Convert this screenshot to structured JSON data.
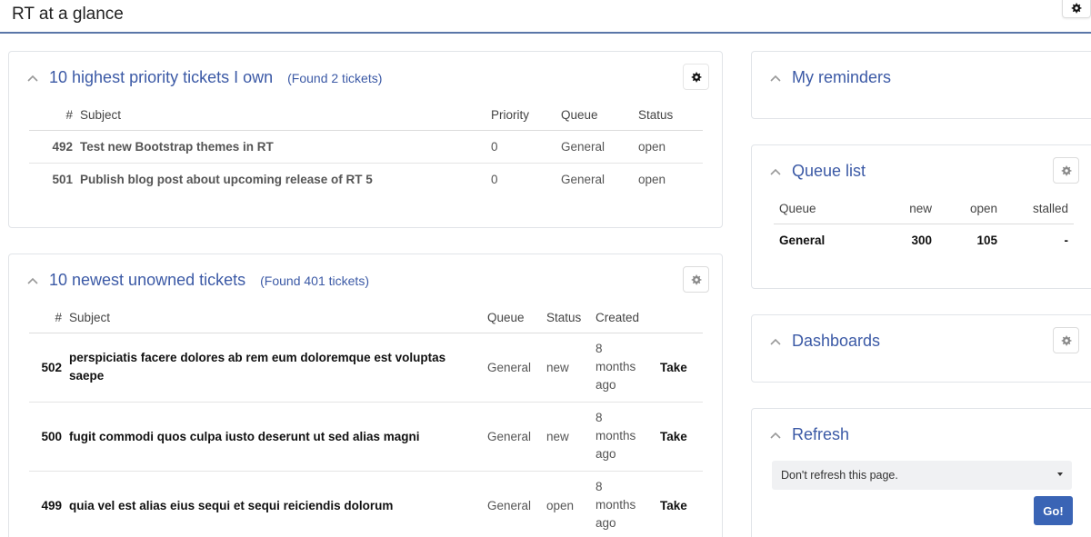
{
  "page": {
    "title": "RT at a glance"
  },
  "priority_panel": {
    "title": "10 highest priority tickets I own",
    "found": "(Found 2 tickets)",
    "columns": {
      "num": "#",
      "subject": "Subject",
      "priority": "Priority",
      "queue": "Queue",
      "status": "Status"
    },
    "rows": [
      {
        "num": "492",
        "subject": "Test new Bootstrap themes in RT",
        "priority": "0",
        "queue": "General",
        "status": "open"
      },
      {
        "num": "501",
        "subject": "Publish blog post about upcoming release of RT 5",
        "priority": "0",
        "queue": "General",
        "status": "open"
      }
    ]
  },
  "unowned_panel": {
    "title": "10 newest unowned tickets",
    "found": "(Found 401 tickets)",
    "columns": {
      "num": "#",
      "subject": "Subject",
      "queue": "Queue",
      "status": "Status",
      "created": "Created"
    },
    "rows": [
      {
        "num": "502",
        "subject": "perspiciatis facere dolores ab rem eum doloremque est voluptas saepe",
        "queue": "General",
        "status": "new",
        "created_1": "8",
        "created_2": "months",
        "created_3": "ago",
        "action": "Take"
      },
      {
        "num": "500",
        "subject": "fugit commodi quos culpa iusto deserunt ut sed alias magni",
        "queue": "General",
        "status": "new",
        "created_1": "8",
        "created_2": "months",
        "created_3": "ago",
        "action": "Take"
      },
      {
        "num": "499",
        "subject": "quia vel est alias eius sequi et sequi reiciendis dolorum",
        "queue": "General",
        "status": "open",
        "created_1": "8",
        "created_2": "months",
        "created_3": "ago",
        "action": "Take"
      }
    ]
  },
  "reminders_panel": {
    "title": "My reminders"
  },
  "queue_panel": {
    "title": "Queue list",
    "columns": {
      "queue": "Queue",
      "new": "new",
      "open": "open",
      "stalled": "stalled"
    },
    "rows": [
      {
        "queue": "General",
        "new": "300",
        "open": "105",
        "stalled": "-"
      }
    ]
  },
  "dashboards_panel": {
    "title": "Dashboards"
  },
  "refresh_panel": {
    "title": "Refresh",
    "selected": "Don't refresh this page.",
    "go_label": "Go!"
  },
  "icons": {
    "gear": "gear-icon",
    "collapse": "chevron-up-icon",
    "dropdown": "caret-down-icon"
  },
  "colors": {
    "accent": "#3c5aa6",
    "button": "#3a64b5",
    "rule": "#5a76a8"
  }
}
